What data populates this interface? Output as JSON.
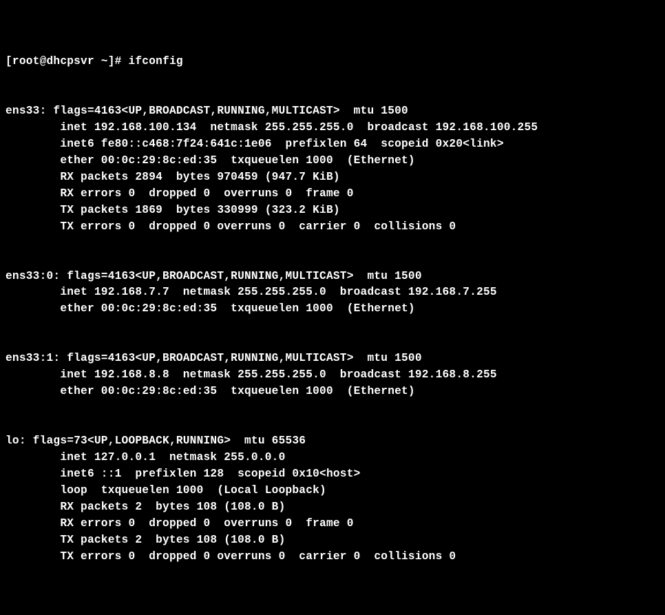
{
  "prompt": "[root@dhcpsvr ~]# ifconfig",
  "interfaces": [
    {
      "header": "ens33: flags=4163<UP,BROADCAST,RUNNING,MULTICAST>  mtu 1500",
      "lines": [
        "        inet 192.168.100.134  netmask 255.255.255.0  broadcast 192.168.100.255",
        "        inet6 fe80::c468:7f24:641c:1e06  prefixlen 64  scopeid 0x20<link>",
        "        ether 00:0c:29:8c:ed:35  txqueuelen 1000  (Ethernet)",
        "        RX packets 2894  bytes 970459 (947.7 KiB)",
        "        RX errors 0  dropped 0  overruns 0  frame 0",
        "        TX packets 1869  bytes 330999 (323.2 KiB)",
        "        TX errors 0  dropped 0 overruns 0  carrier 0  collisions 0"
      ]
    },
    {
      "header": "ens33:0: flags=4163<UP,BROADCAST,RUNNING,MULTICAST>  mtu 1500",
      "lines": [
        "        inet 192.168.7.7  netmask 255.255.255.0  broadcast 192.168.7.255",
        "        ether 00:0c:29:8c:ed:35  txqueuelen 1000  (Ethernet)"
      ]
    },
    {
      "header": "ens33:1: flags=4163<UP,BROADCAST,RUNNING,MULTICAST>  mtu 1500",
      "lines": [
        "        inet 192.168.8.8  netmask 255.255.255.0  broadcast 192.168.8.255",
        "        ether 00:0c:29:8c:ed:35  txqueuelen 1000  (Ethernet)"
      ]
    },
    {
      "header": "lo: flags=73<UP,LOOPBACK,RUNNING>  mtu 65536",
      "lines": [
        "        inet 127.0.0.1  netmask 255.0.0.0",
        "        inet6 ::1  prefixlen 128  scopeid 0x10<host>",
        "        loop  txqueuelen 1000  (Local Loopback)",
        "        RX packets 2  bytes 108 (108.0 B)",
        "        RX errors 0  dropped 0  overruns 0  frame 0",
        "        TX packets 2  bytes 108 (108.0 B)",
        "        TX errors 0  dropped 0 overruns 0  carrier 0  collisions 0"
      ]
    }
  ]
}
